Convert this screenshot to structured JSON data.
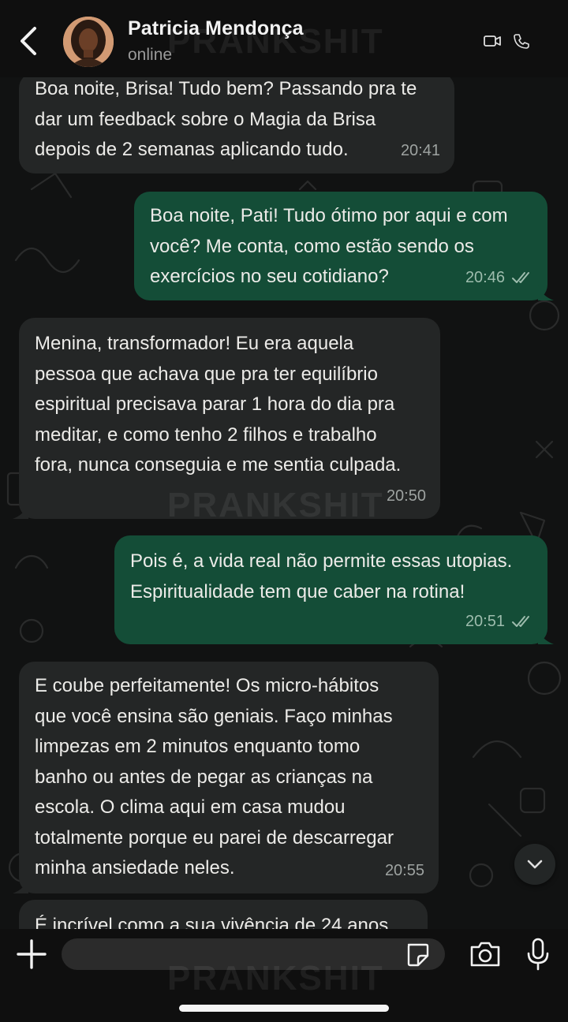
{
  "header": {
    "contact_name": "Patricia Mendonça",
    "status": "online"
  },
  "watermark": "PRANKSHIT",
  "messages": [
    {
      "direction": "in",
      "text": "Boa noite, Brisa! Tudo bem? Passando pra te\ndar um feedback sobre o Magia da Brisa\ndepois de 2 semanas aplicando tudo.",
      "time": "20:41"
    },
    {
      "direction": "out",
      "text": "Boa noite, Pati! Tudo ótimo por aqui e com\nvocê? Me conta, como estão sendo os\nexercícios no seu cotidiano?",
      "time": "20:46",
      "read": true
    },
    {
      "direction": "in",
      "text": "Menina, transformador! Eu era aquela\npessoa que achava que pra ter equilíbrio\nespiritual precisava parar 1 hora do dia pra\nmeditar, e como tenho 2 filhos e trabalho\nfora, nunca conseguia e me sentia culpada.",
      "time": "20:50"
    },
    {
      "direction": "out",
      "text": "Pois é, a vida real não permite essas utopias.\nEspiritualidade tem que caber na rotina!",
      "time": "20:51",
      "read": true
    },
    {
      "direction": "in",
      "text": "E coube perfeitamente! Os micro-hábitos\nque você ensina são geniais. Faço minhas\nlimpezas em 2 minutos enquanto tomo\nbanho ou antes de pegar as crianças na\nescola. O clima aqui em casa mudou\ntotalmente porque eu parei de descarregar\nminha ansiedade neles.",
      "time": "20:55"
    },
    {
      "direction": "in",
      "text": "É incrível como a sua vivência de 24 anos",
      "time": ""
    }
  ],
  "input": {
    "placeholder": ""
  },
  "icons": {
    "back": "chevron-left-icon",
    "video": "video-camera-icon",
    "call": "phone-icon",
    "scroll": "chevron-down-icon",
    "plus": "plus-icon",
    "sticker": "sticker-icon",
    "camera": "camera-icon",
    "mic": "microphone-icon"
  },
  "colors": {
    "incoming_bubble": "#242626",
    "outgoing_bubble": "#144d37",
    "background": "#111212"
  }
}
